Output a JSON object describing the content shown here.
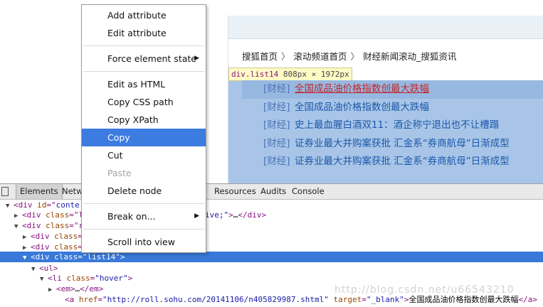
{
  "page": {
    "breadcrumb": [
      "搜狐首页",
      "滚动频道首页",
      "财经新闻滚动_搜狐资讯"
    ],
    "breadcrumb_sep": "〉",
    "inspect_tip": {
      "selector": "div.list14",
      "size": "808px × 1972px"
    },
    "news": [
      {
        "category": "[财经]",
        "title": "全国成品油价格指数创最大跌幅"
      },
      {
        "category": "[财经]",
        "title": "全国成品油价格指数创最大跌幅"
      },
      {
        "category": "[财经]",
        "title": "史上最血腥白酒双11：酒企称宁退出也不让槽蹋"
      },
      {
        "category": "[财经]",
        "title": "证券业最大并购案获批 汇金系“券商航母”日渐成型"
      },
      {
        "category": "[财经]",
        "title": "证券业最大并购案获批 汇金系“券商航母”日渐成型"
      }
    ]
  },
  "devtools": {
    "tabs": [
      "Elements",
      "Netw",
      "Resources",
      "Audits",
      "Console"
    ],
    "dom": [
      {
        "tri": "▼",
        "parts": [
          [
            "tag",
            "<div "
          ],
          [
            "attr",
            "id"
          ],
          [
            "tag",
            "=\""
          ],
          [
            "val",
            "conte"
          ]
        ]
      },
      {
        "tri": "▶",
        "parts": [
          [
            "tag",
            "<div "
          ],
          [
            "attr",
            "class"
          ],
          [
            "tag",
            "=\"l"
          ],
          [
            "val",
            ""
          ]
        ],
        "tail": [
          [
            "val",
            "ive;\""
          ],
          [
            "tag",
            ">"
          ],
          [
            "txt",
            "…"
          ],
          [
            "tag",
            "</div>"
          ]
        ]
      },
      {
        "tri": "▼",
        "parts": [
          [
            "tag",
            "<div "
          ],
          [
            "attr",
            "class"
          ],
          [
            "tag",
            "=\"r"
          ]
        ]
      },
      {
        "tri": "▶",
        "parts": [
          [
            "tag",
            "<div "
          ],
          [
            "attr",
            "class"
          ],
          [
            "tag",
            "="
          ]
        ]
      },
      {
        "tri": "▶",
        "parts": [
          [
            "tag",
            "<div "
          ],
          [
            "attr",
            "class"
          ],
          [
            "tag",
            "="
          ]
        ]
      },
      {
        "tri": "▼",
        "parts": [
          [
            "tag",
            "<div "
          ],
          [
            "attr",
            "class"
          ],
          [
            "tag",
            "="
          ],
          [
            "val",
            "\"list14\""
          ],
          [
            "tag",
            ">"
          ]
        ],
        "selected": true
      },
      {
        "tri": "▼",
        "parts": [
          [
            "tag",
            "<ul>"
          ]
        ]
      },
      {
        "tri": "▼",
        "parts": [
          [
            "tag",
            "<li "
          ],
          [
            "attr",
            "class"
          ],
          [
            "tag",
            "="
          ],
          [
            "val",
            "\"hover\""
          ],
          [
            "tag",
            ">"
          ]
        ]
      },
      {
        "tri": "▶",
        "parts": [
          [
            "tag",
            "<em>"
          ],
          [
            "txt",
            "…"
          ],
          [
            "tag",
            "</em>"
          ]
        ]
      },
      {
        "tri": "",
        "parts": [
          [
            "tag",
            "<a "
          ],
          [
            "attr",
            "href"
          ],
          [
            "tag",
            "="
          ],
          [
            "val",
            "\"http://roll.sohu.com/20141106/n405829987.shtml\""
          ],
          [
            "tag",
            " "
          ],
          [
            "attr",
            "target"
          ],
          [
            "tag",
            "="
          ],
          [
            "val",
            "\"_blank\""
          ],
          [
            "tag",
            ">"
          ],
          [
            "txt",
            "全国成品油价格指数创最大跌幅"
          ],
          [
            "tag",
            "</a>"
          ]
        ]
      }
    ],
    "watermark": "http://blog.csdn.net/u66543210"
  },
  "context_menu": {
    "items": [
      {
        "label": "Add attribute"
      },
      {
        "label": "Edit attribute"
      },
      {
        "sep": true
      },
      {
        "label": "Force element state",
        "submenu": true
      },
      {
        "sep": true
      },
      {
        "label": "Edit as HTML"
      },
      {
        "label": "Copy CSS path"
      },
      {
        "label": "Copy XPath"
      },
      {
        "label": "Copy",
        "active": true
      },
      {
        "label": "Cut"
      },
      {
        "label": "Paste",
        "disabled": true
      },
      {
        "label": "Delete node"
      },
      {
        "sep": true
      },
      {
        "label": "Break on...",
        "submenu": true
      },
      {
        "sep": true
      },
      {
        "label": "Scroll into view"
      }
    ]
  },
  "colors": {
    "selection": "#3879d9",
    "menu_active": "#3c7be0",
    "page_highlight": "#a8c5e8"
  },
  "icons": {
    "submenu": "chevron-right-icon",
    "dock": "dock-icon"
  }
}
